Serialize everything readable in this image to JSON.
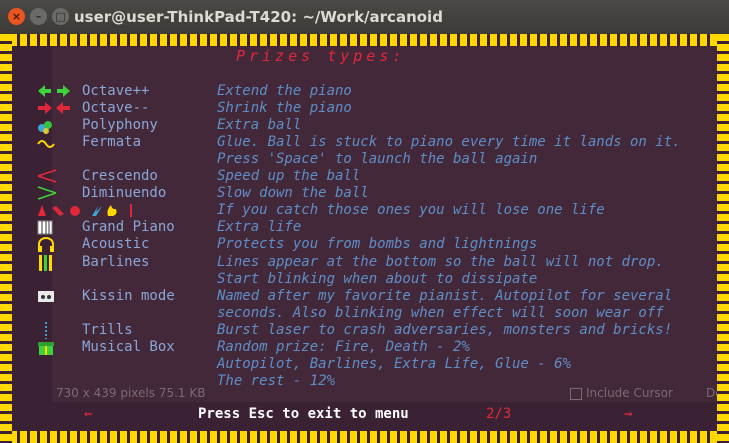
{
  "window": {
    "title": "user@user-ThinkPad-T420: ~/Work/arcanoid",
    "close": "×",
    "minimize": "–",
    "maximize": "□"
  },
  "heading": "Prizes types:",
  "rows": [
    {
      "name": "Octave++",
      "desc": "Extend the piano",
      "icon": "double-arrow-out-icon"
    },
    {
      "name": "Octave--",
      "desc": "Shrink the piano",
      "icon": "double-arrow-in-icon"
    },
    {
      "name": "Polyphony",
      "desc": "Extra ball",
      "icon": "notes-icon"
    },
    {
      "name": "Fermata",
      "desc": "Glue. Ball is stuck to piano every time it lands on it.",
      "icon": "fermata-icon"
    },
    {
      "name": "",
      "desc": "Press 'Space' to launch the ball again",
      "icon": ""
    },
    {
      "name": "Crescendo",
      "desc": "Speed up the ball",
      "icon": "crescendo-icon"
    },
    {
      "name": "Diminuendo",
      "desc": "Slow down the ball",
      "icon": "diminuendo-icon"
    },
    {
      "name": "",
      "desc": "If you catch  those ones you will lose one life",
      "icon": "danger-icons"
    },
    {
      "name": "Grand Piano",
      "desc": "Extra life",
      "icon": "piano-icon"
    },
    {
      "name": "Acoustic",
      "desc": "Protects you from bombs and lightnings",
      "icon": "headphones-icon"
    },
    {
      "name": "Barlines",
      "desc": "Lines appear at the bottom so the ball will not drop.",
      "icon": "barlines-icon"
    },
    {
      "name": "",
      "desc": "Start blinking when about to dissipate",
      "icon": ""
    },
    {
      "name": "Kissin mode",
      "desc": "Named after my favorite pianist. Autopilot for several",
      "icon": "tape-icon"
    },
    {
      "name": "",
      "desc": "seconds. Also blinking when effect will soon wear off",
      "icon": ""
    },
    {
      "name": "Trills",
      "desc": "Burst laser to crash adversaries, monsters and bricks!",
      "icon": "trill-icon"
    },
    {
      "name": "Musical Box",
      "desc": "Random prize: Fire, Death - 2%",
      "icon": "gift-icon"
    },
    {
      "name": "",
      "desc": "Autopilot, Barlines, Extra Life, Glue - 6%",
      "icon": ""
    },
    {
      "name": "",
      "desc": "The rest  - 12%",
      "icon": ""
    }
  ],
  "ghost": {
    "pixels": "730 x 439 pixels  75.1 KB",
    "cursor": "Include Cursor",
    "del": "De"
  },
  "status": {
    "hint": "Press Esc to exit to menu",
    "page": "2/3",
    "left_arrow": "⇜",
    "right_arrow": "⇝"
  },
  "colors": {
    "border": "#ffd800",
    "heading": "#e0283a",
    "name": "#8aa6d6",
    "desc": "#5f8ec7",
    "bg": "#3b2134"
  }
}
